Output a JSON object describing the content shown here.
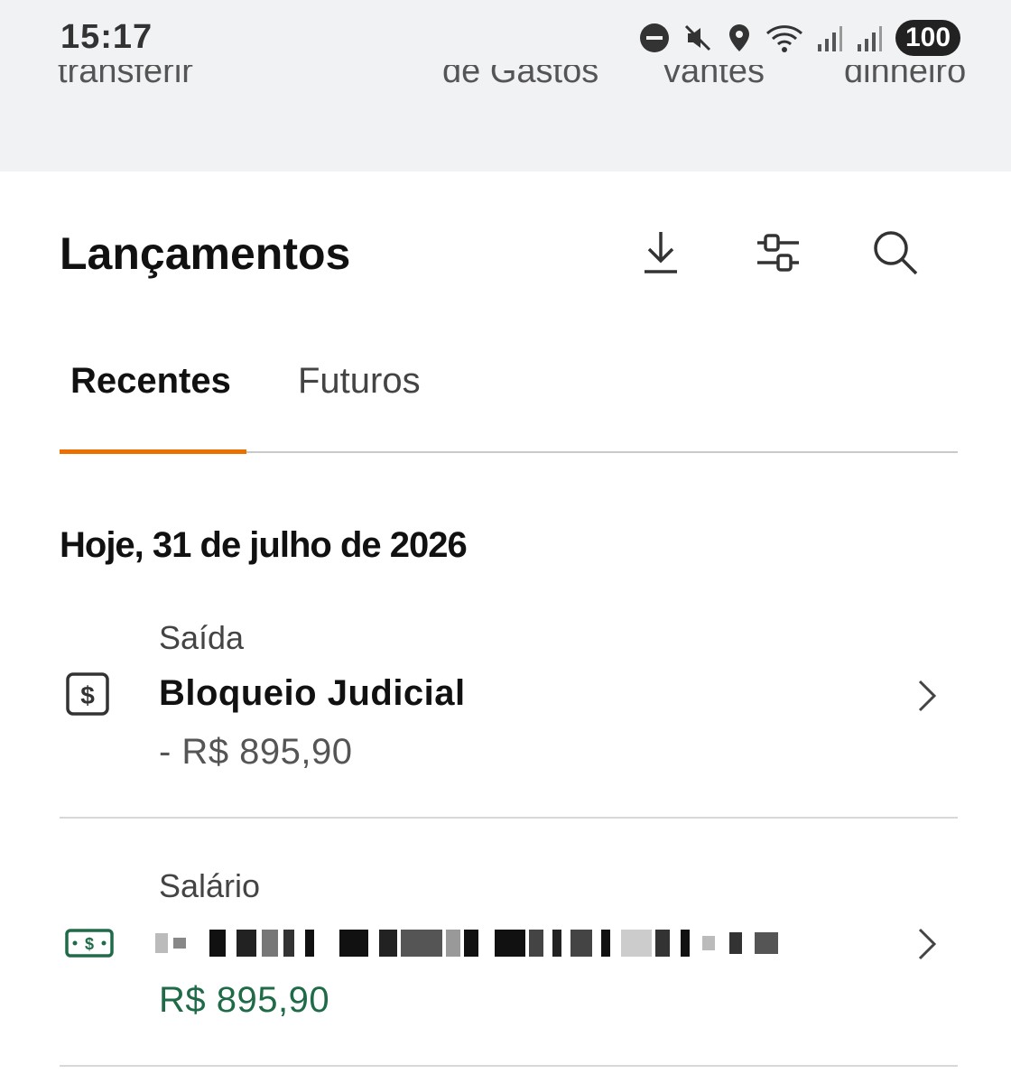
{
  "status_bar": {
    "time": "15:17",
    "battery": "100"
  },
  "shortcuts": [
    "transferir",
    "de Gastos",
    "vantes",
    "dinheiro"
  ],
  "header": {
    "title": "Lançamentos"
  },
  "tabs": [
    {
      "label": "Recentes",
      "active": true
    },
    {
      "label": "Futuros",
      "active": false
    }
  ],
  "date_heading": "Hoje, 31 de julho de 2026",
  "transactions": [
    {
      "type": "Saída",
      "title": "Bloqueio Judicial",
      "amount": "- R$ 895,90",
      "icon": "dollar-box-icon"
    },
    {
      "type": "Salário",
      "title": "",
      "amount": "R$ 895,90",
      "icon": "cash-bill-icon"
    }
  ],
  "colors": {
    "accent": "#ec7000",
    "positive": "#1f6b48"
  }
}
